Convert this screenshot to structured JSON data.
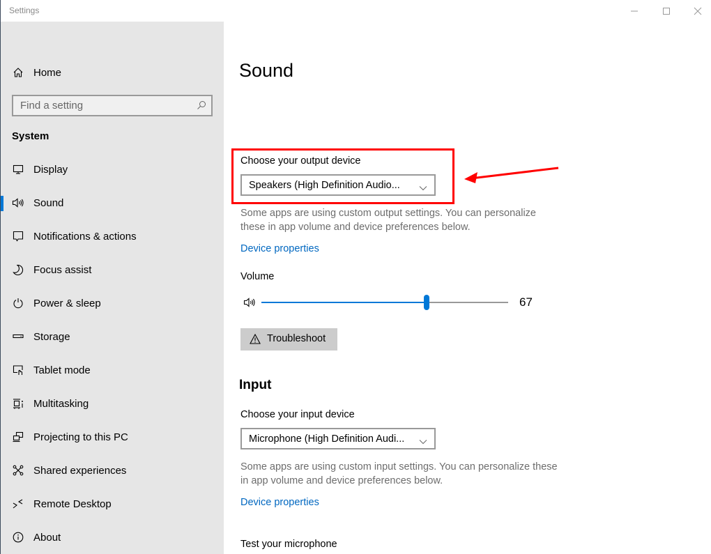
{
  "window": {
    "title": "Settings",
    "controls": {
      "minimize": "minimize-icon",
      "maximize": "maximize-icon",
      "close": "close-icon"
    }
  },
  "sidebar": {
    "home": {
      "label": "Home",
      "icon": "home-icon"
    },
    "search": {
      "placeholder": "Find a setting",
      "value": "",
      "icon": "search-icon"
    },
    "section_title": "System",
    "items": [
      {
        "label": "Display",
        "icon": "display-icon",
        "active": false
      },
      {
        "label": "Sound",
        "icon": "speaker-icon",
        "active": true
      },
      {
        "label": "Notifications & actions",
        "icon": "notifications-icon",
        "active": false
      },
      {
        "label": "Focus assist",
        "icon": "moon-icon",
        "active": false
      },
      {
        "label": "Power & sleep",
        "icon": "power-icon",
        "active": false
      },
      {
        "label": "Storage",
        "icon": "storage-icon",
        "active": false
      },
      {
        "label": "Tablet mode",
        "icon": "tablet-mode-icon",
        "active": false
      },
      {
        "label": "Multitasking",
        "icon": "multitasking-icon",
        "active": false
      },
      {
        "label": "Projecting to this PC",
        "icon": "projecting-icon",
        "active": false
      },
      {
        "label": "Shared experiences",
        "icon": "shared-experiences-icon",
        "active": false
      },
      {
        "label": "Remote Desktop",
        "icon": "remote-desktop-icon",
        "active": false
      },
      {
        "label": "About",
        "icon": "info-icon",
        "active": false
      }
    ]
  },
  "main": {
    "title": "Sound",
    "output": {
      "label": "Choose your output device",
      "selected": "Speakers (High Definition Audio...",
      "description": "Some apps are using custom output settings. You can personalize these in app volume and device preferences below.",
      "link": "Device properties",
      "volume_label": "Volume",
      "volume": 67,
      "volume_display": "67",
      "troubleshoot_label": "Troubleshoot"
    },
    "input": {
      "heading": "Input",
      "label": "Choose your input device",
      "selected": "Microphone (High Definition Audi...",
      "description": "Some apps are using custom input settings. You can personalize these in app volume and device preferences below.",
      "link": "Device properties",
      "test_label": "Test your microphone"
    }
  },
  "annotation": {
    "highlight_color": "#ff0000",
    "target": "output-device-section"
  },
  "colors": {
    "accent": "#0078d7",
    "link": "#0067c0",
    "sidebar_bg": "#e6e6e6"
  }
}
